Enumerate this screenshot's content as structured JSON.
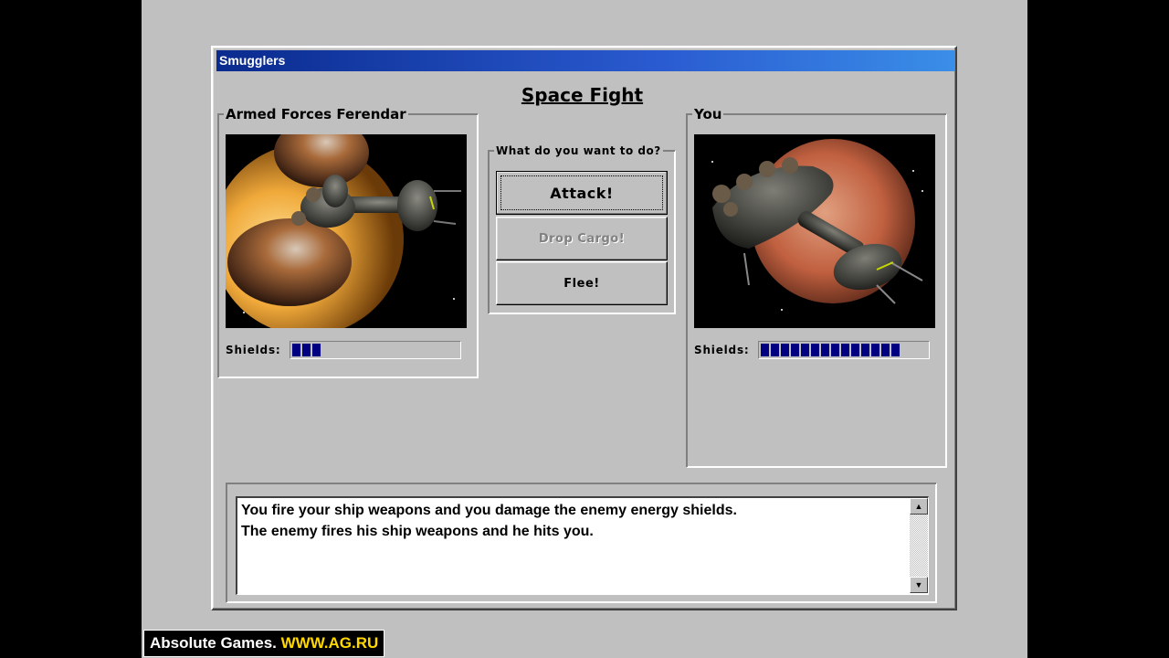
{
  "window": {
    "title": "Smugglers",
    "heading": "Space Fight"
  },
  "enemy": {
    "name": "Armed Forces Ferendar",
    "shields_label": "Shields:",
    "shield_segments": 3,
    "shield_max_segments": 18
  },
  "player": {
    "name": "You",
    "shields_label": "Shields:",
    "shield_segments": 14,
    "shield_max_segments": 18
  },
  "actions": {
    "prompt": "What do you want to do?",
    "attack_label": "Attack!",
    "drop_cargo_label": "Drop Cargo!",
    "flee_label": "Flee!"
  },
  "log": {
    "lines": [
      "You fire your ship weapons and you damage the enemy energy shields.",
      "The enemy fires his ship weapons and he hits you."
    ]
  },
  "watermark": {
    "text": "Absolute Games.",
    "url": "WWW.AG.RU"
  },
  "icons": {
    "scroll_up": "scroll-up-arrow-icon",
    "scroll_down": "scroll-down-arrow-icon"
  },
  "colors": {
    "title_bar": "#0a2a8e",
    "shield_segment": "#000080",
    "window_bg": "#c0c0c0",
    "watermark_url": "#ffd800"
  }
}
